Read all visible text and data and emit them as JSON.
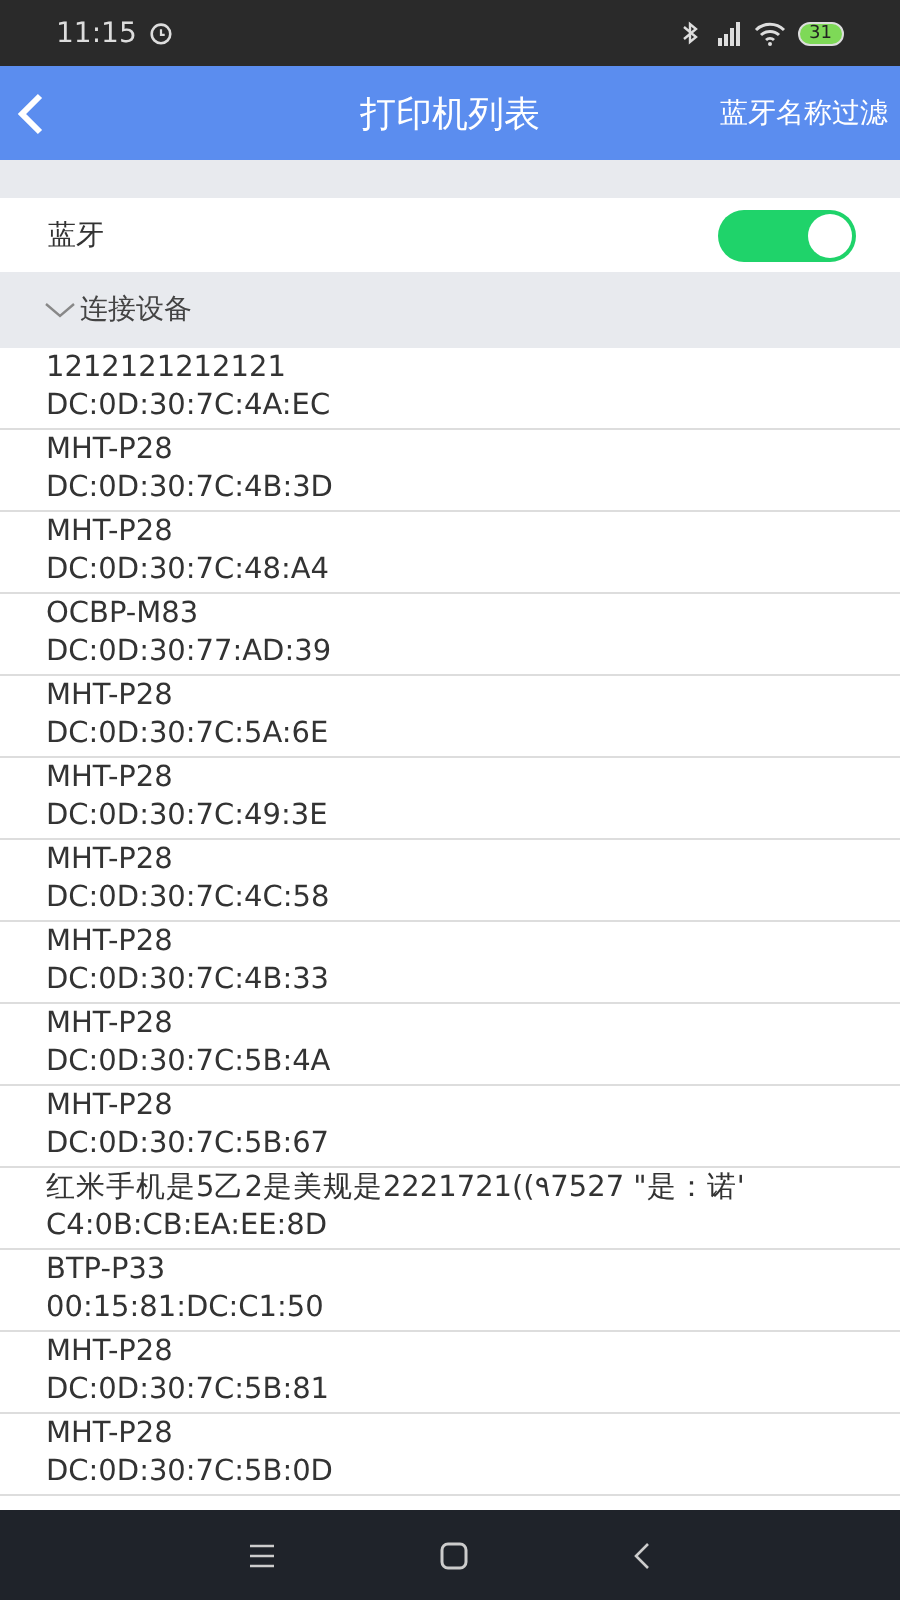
{
  "status_bar": {
    "time": "11:15",
    "battery": "31"
  },
  "header": {
    "title": "打印机列表",
    "action": "蓝牙名称过滤"
  },
  "bluetooth": {
    "label": "蓝牙",
    "on": true
  },
  "section": {
    "title": "连接设备",
    "expanded": true
  },
  "devices": [
    {
      "name": "1212121212121",
      "address": "DC:0D:30:7C:4A:EC"
    },
    {
      "name": "MHT-P28",
      "address": "DC:0D:30:7C:4B:3D"
    },
    {
      "name": "MHT-P28",
      "address": "DC:0D:30:7C:48:A4"
    },
    {
      "name": "OCBP-M83",
      "address": "DC:0D:30:77:AD:39"
    },
    {
      "name": "MHT-P28",
      "address": "DC:0D:30:7C:5A:6E"
    },
    {
      "name": "MHT-P28",
      "address": "DC:0D:30:7C:49:3E"
    },
    {
      "name": "MHT-P28",
      "address": "DC:0D:30:7C:4C:58"
    },
    {
      "name": "MHT-P28",
      "address": "DC:0D:30:7C:4B:33"
    },
    {
      "name": "MHT-P28",
      "address": "DC:0D:30:7C:5B:4A"
    },
    {
      "name": "MHT-P28",
      "address": "DC:0D:30:7C:5B:67"
    },
    {
      "name": "红米手机是5乙2是美规是2221721((٩7527 \"是：诺'",
      "address": "C4:0B:CB:EA:EE:8D"
    },
    {
      "name": "BTP-P33",
      "address": "00:15:81:DC:C1:50"
    },
    {
      "name": "MHT-P28",
      "address": "DC:0D:30:7C:5B:81"
    },
    {
      "name": "MHT-P28",
      "address": "DC:0D:30:7C:5B:0D"
    }
  ]
}
